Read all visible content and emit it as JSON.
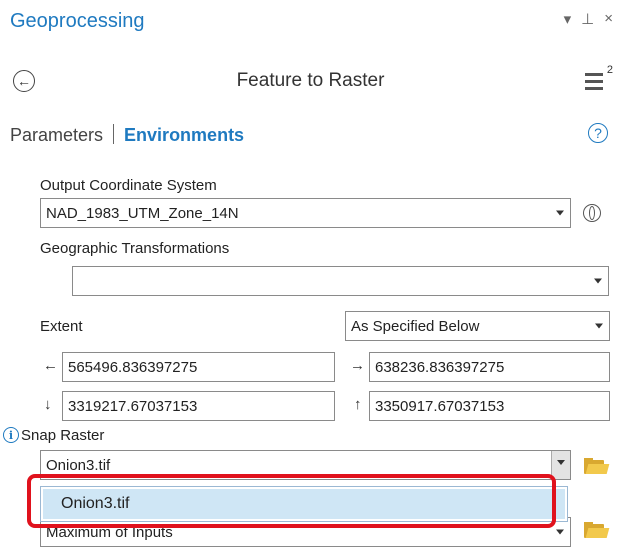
{
  "pane": {
    "title": "Geoprocessing",
    "controls": {
      "dropdown": "▾",
      "pin": "⊥",
      "close": "×"
    }
  },
  "tool": {
    "back": "←",
    "title": "Feature to Raster",
    "menu_badge": "2"
  },
  "tabs": {
    "parameters": "Parameters",
    "environments": "Environments",
    "help": "?"
  },
  "environments": {
    "output_coordinate_system": {
      "label": "Output Coordinate System",
      "value": "NAD_1983_UTM_Zone_14N"
    },
    "geographic_transformations": {
      "label": "Geographic Transformations",
      "value": ""
    },
    "extent": {
      "label": "Extent",
      "mode": "As Specified Below",
      "left": "565496.836397275",
      "right": "638236.836397275",
      "bottom": "3319217.67037153",
      "top": "3350917.67037153",
      "arrows": {
        "left": "←",
        "right": "→",
        "bottom": "↓",
        "top": "↑"
      }
    },
    "snap_raster": {
      "label": "Snap Raster",
      "value": "Onion3.tif",
      "dropdown_options": [
        "Onion3.tif"
      ]
    },
    "cell_size": {
      "value": "Maximum of Inputs"
    }
  },
  "icons": {
    "back": "back-arrow-icon",
    "menu": "hamburger-menu-icon",
    "help": "help-icon",
    "globe": "globe-icon",
    "info": "info-icon",
    "folder": "folder-icon"
  },
  "colors": {
    "accent": "#1f7ac0",
    "highlight": "#e0121d",
    "selected": "#cfe6f5",
    "folder": "#f2c94c"
  }
}
